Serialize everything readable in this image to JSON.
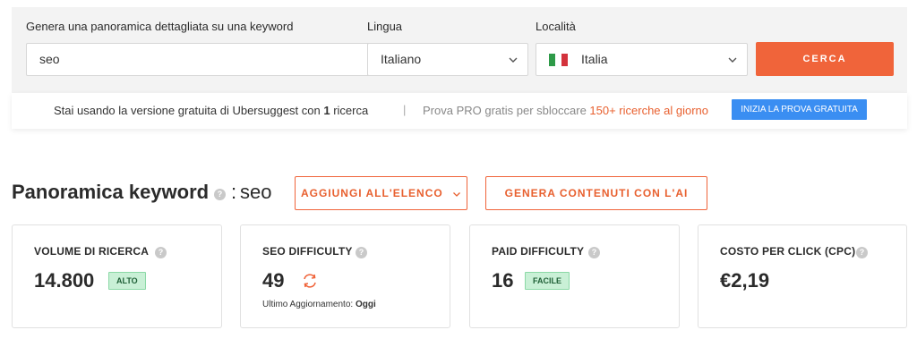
{
  "search": {
    "keyword_label": "Genera una panoramica dettagliata su una keyword",
    "keyword_value": "seo",
    "language_label": "Lingua",
    "language_value": "Italiano",
    "location_label": "Località",
    "location_value": "Italia",
    "flag_colors": [
      "#2e9a48",
      "#ffffff",
      "#d3323c"
    ],
    "button_label": "CERCA",
    "button_color": "#f0643a"
  },
  "promo": {
    "free_text_before": "Stai usando la versione gratuita di Ubersuggest con ",
    "free_count": "1",
    "free_text_after": " ricerca",
    "separator": "|",
    "pro_text": "Prova PRO gratis per sbloccare ",
    "pro_highlight": "150+ ricerche al giorno",
    "trial_button": "INIZIA LA PROVA GRATUITA",
    "trial_color": "#3a8ef2"
  },
  "overview": {
    "title": "Panoramica keyword",
    "info_icon": "?",
    "colon": ":",
    "keyword": "seo",
    "add_to_list_label": "AGGIUNGI ALL'ELENCO",
    "generate_ai_label": "GENERA CONTENUTI CON L'AI",
    "accent_color": "#f0643a"
  },
  "metrics": [
    {
      "label": "VOLUME DI RICERCA",
      "value": "14.800",
      "badge": "ALTO"
    },
    {
      "label": "SEO DIFFICULTY",
      "value": "49",
      "updated_label": "Ultimo Aggiornamento:",
      "updated_value": "Oggi",
      "icon": "refresh-icon"
    },
    {
      "label": "PAID DIFFICULTY",
      "value": "16",
      "badge": "FACILE"
    },
    {
      "label": "COSTO PER CLICK (CPC)",
      "value": "€2,19"
    }
  ]
}
